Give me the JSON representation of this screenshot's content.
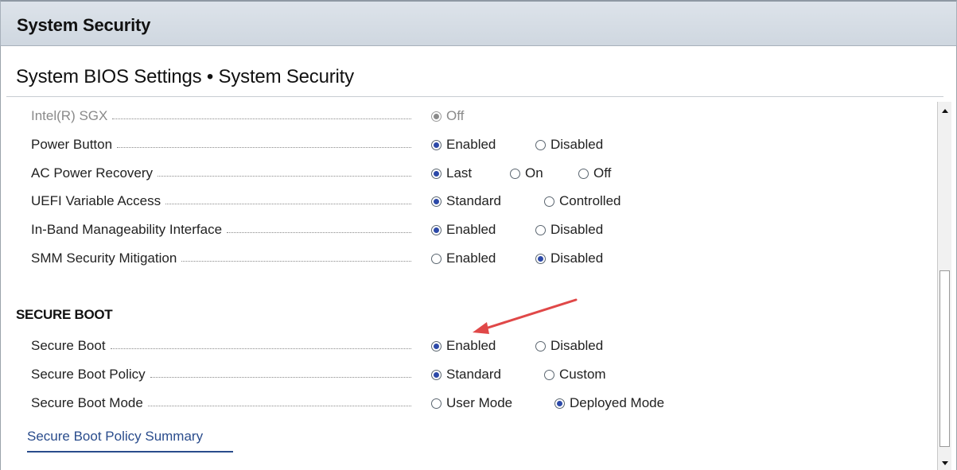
{
  "header": {
    "title": "System Security"
  },
  "page": {
    "title": "System BIOS Settings • System Security"
  },
  "settings": [
    {
      "label": "Intel(R) SGX",
      "options": [
        {
          "label": "Off",
          "checked": true
        }
      ]
    },
    {
      "label": "Power Button",
      "options": [
        {
          "label": "Enabled",
          "checked": true
        },
        {
          "label": "Disabled",
          "checked": false
        }
      ]
    },
    {
      "label": "AC Power Recovery",
      "options": [
        {
          "label": "Last",
          "checked": true
        },
        {
          "label": "On",
          "checked": false
        },
        {
          "label": "Off",
          "checked": false
        }
      ]
    },
    {
      "label": "UEFI Variable Access",
      "options": [
        {
          "label": "Standard",
          "checked": true
        },
        {
          "label": "Controlled",
          "checked": false
        }
      ]
    },
    {
      "label": "In-Band Manageability Interface",
      "options": [
        {
          "label": "Enabled",
          "checked": true
        },
        {
          "label": "Disabled",
          "checked": false
        }
      ]
    },
    {
      "label": "SMM Security Mitigation",
      "options": [
        {
          "label": "Enabled",
          "checked": false
        },
        {
          "label": "Disabled",
          "checked": true
        }
      ]
    }
  ],
  "secure_boot": {
    "heading": "SECURE BOOT",
    "settings": [
      {
        "label": "Secure Boot",
        "options": [
          {
            "label": "Enabled",
            "checked": true
          },
          {
            "label": "Disabled",
            "checked": false
          }
        ]
      },
      {
        "label": "Secure Boot Policy",
        "options": [
          {
            "label": "Standard",
            "checked": true
          },
          {
            "label": "Custom",
            "checked": false
          }
        ]
      },
      {
        "label": "Secure Boot Mode",
        "options": [
          {
            "label": "User Mode",
            "checked": false
          },
          {
            "label": "Deployed Mode",
            "checked": true
          }
        ]
      }
    ],
    "summary_link": "Secure Boot Policy Summary"
  },
  "colors": {
    "radio_selected": "#2c49a8",
    "link": "#2a4c8c",
    "annotation_arrow": "#e04848"
  }
}
